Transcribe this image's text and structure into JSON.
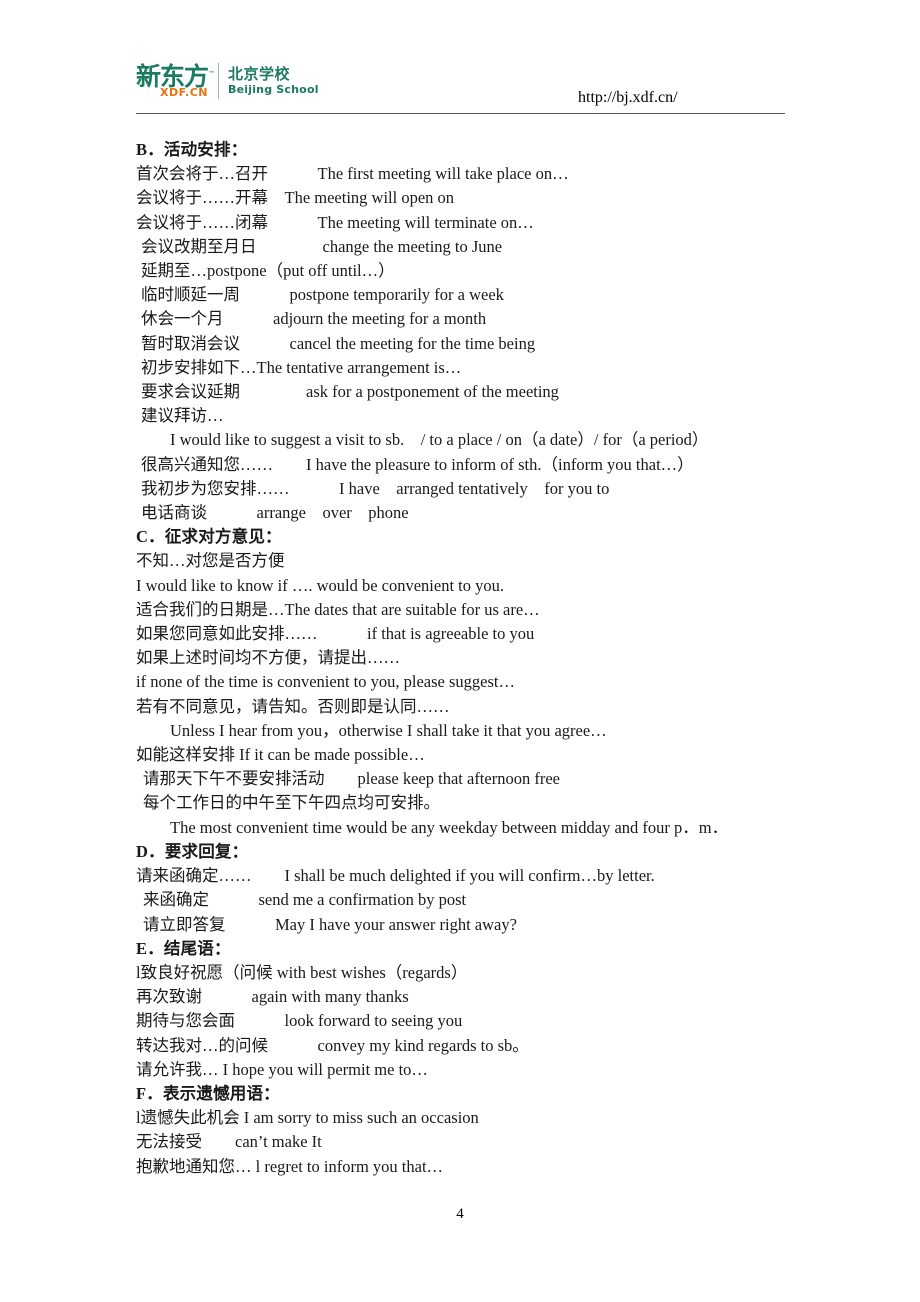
{
  "header": {
    "logo": {
      "brand_cn": "新东方",
      "trademark": "™",
      "brand_domain": "XDF.CN",
      "school_cn": "北京学校",
      "school_en": "Beijing School",
      "brand_color": "#1c7a60",
      "domain_color": "#e8710a"
    },
    "url": "http://bj.xdf.cn/"
  },
  "document": {
    "lines": [
      {
        "text": "B．活动安排：",
        "style": "heading"
      },
      {
        "text": "首次会将于…召开　　　The first meeting will take place on…",
        "style": "normal"
      },
      {
        "text": "会议将于……开幕　The meeting will open on",
        "style": "normal"
      },
      {
        "text": "会议将于……闭幕　　　The meeting will terminate on…",
        "style": "normal"
      },
      {
        "text": "会议改期至月日　　　　change the meeting to June",
        "style": "ind1"
      },
      {
        "text": "延期至…postpone（put off until…）",
        "style": "ind1"
      },
      {
        "text": "临时顺延一周　　　postpone temporarily for a week",
        "style": "ind1"
      },
      {
        "text": "休会一个月　　　adjourn the meeting for a month",
        "style": "ind1"
      },
      {
        "text": "暂时取消会议　　　cancel the meeting for the time being",
        "style": "ind1"
      },
      {
        "text": "初步安排如下…The tentative arrangement is…",
        "style": "ind1"
      },
      {
        "text": "要求会议延期　　　　ask for a postponement of the meeting",
        "style": "ind1"
      },
      {
        "text": "建议拜访…",
        "style": "ind1"
      },
      {
        "text": "I would like to suggest a visit to sb.　/ to a place / on（a date）/ for（a period）",
        "style": "ind3"
      },
      {
        "text": "很高兴通知您……　　I have the pleasure to inform of sth.（inform you that…）",
        "style": "ind1"
      },
      {
        "text": "我初步为您安排……　　　I have　arranged tentatively　for you to",
        "style": "ind1"
      },
      {
        "text": "电话商谈　　　arrange　over　phone",
        "style": "ind1"
      },
      {
        "text": "C．征求对方意见：",
        "style": "heading"
      },
      {
        "text": "不知…对您是否方便",
        "style": "normal"
      },
      {
        "text": "I would like to know if …. would be convenient to you.",
        "style": "normal"
      },
      {
        "text": "适合我们的日期是…The dates that are suitable for us are…",
        "style": "normal"
      },
      {
        "text": "如果您同意如此安排……　　　if that is agreeable to you",
        "style": "normal"
      },
      {
        "text": "如果上述时间均不方便，请提出……",
        "style": "normal"
      },
      {
        "text": "if none of the time is convenient to you, please suggest…",
        "style": "normal"
      },
      {
        "text": "若有不同意见，请告知。否则即是认同……",
        "style": "normal"
      },
      {
        "text": "Unless I hear from you，otherwise I shall take it that you agree…",
        "style": "ind3"
      },
      {
        "text": "如能这样安排 If it can be made possible…",
        "style": "normal"
      },
      {
        "text": "请那天下午不要安排活动　　please keep that afternoon free",
        "style": "ind2"
      },
      {
        "text": "每个工作日的中午至下午四点均可安排。",
        "style": "ind2"
      },
      {
        "text": "The most convenient time would be any weekday between midday and four p．m．",
        "style": "ind3"
      },
      {
        "text": "D．要求回复：",
        "style": "heading"
      },
      {
        "text": "请来函确定……　　I shall be much delighted if you will confirm…by letter.",
        "style": "normal"
      },
      {
        "text": "来函确定　　　send me a confirmation by post",
        "style": "ind2"
      },
      {
        "text": "请立即答复　　　May I have your answer right away?",
        "style": "ind2"
      },
      {
        "text": "E．结尾语：",
        "style": "heading"
      },
      {
        "text": "l致良好祝愿（问候 with best wishes（regards）",
        "style": "normal"
      },
      {
        "text": "再次致谢　　　again with many thanks",
        "style": "normal"
      },
      {
        "text": "期待与您会面　　　look forward to seeing you",
        "style": "normal"
      },
      {
        "text": "转达我对…的问候　　　convey my kind regards to sb。",
        "style": "normal"
      },
      {
        "text": "请允许我… I hope you will permit me to…",
        "style": "normal"
      },
      {
        "text": "F．表示遗憾用语：",
        "style": "heading"
      },
      {
        "text": "l遗憾失此机会 I am sorry to miss such an occasion",
        "style": "normal"
      },
      {
        "text": "无法接受　　can’t make It",
        "style": "normal"
      },
      {
        "text": "抱歉地通知您… l regret to inform you that…",
        "style": "normal"
      }
    ]
  },
  "footer": {
    "page_number": "4"
  }
}
